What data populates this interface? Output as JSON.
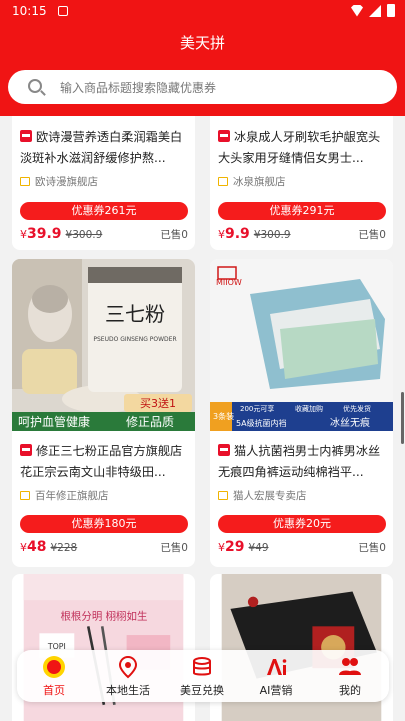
{
  "status": {
    "time": "10:15"
  },
  "header": {
    "title": "美天拼"
  },
  "search": {
    "placeholder": "输入商品标题搜索隐藏优惠券"
  },
  "products": [
    {
      "title": "欧诗漫营养透白柔润霜美白淡斑补水滋润舒缓修护熬...",
      "shop": "欧诗漫旗舰店",
      "coupon": "优惠券261元",
      "currency": "¥",
      "price": "39.9",
      "original": "¥300.9",
      "sold": "已售0"
    },
    {
      "title": "冰泉成人牙刷软毛护龈宽头大头家用牙缝情侣女男士...",
      "shop": "冰泉旗舰店",
      "coupon": "优惠券291元",
      "currency": "¥",
      "price": "9.9",
      "original": "¥300.9",
      "sold": "已售0"
    },
    {
      "title": "修正三七粉正品官方旗舰店花正宗云南文山非特级田...",
      "shop": "百年修正旗舰店",
      "coupon": "优惠券180元",
      "currency": "¥",
      "price": "48",
      "original": "¥228",
      "sold": "已售0",
      "image_texts": [
        "三七粉",
        "PSEUDO GINSENG POWDER",
        "呵护血管健康",
        "修正品质",
        "买3送1"
      ]
    },
    {
      "title": "猫人抗菌裆男士内裤男冰丝无痕四角裤运动纯棉裆平...",
      "shop": "猫人宏展专卖店",
      "coupon": "优惠券20元",
      "currency": "¥",
      "price": "29",
      "original": "¥49",
      "sold": "已售0",
      "image_texts": [
        "MIIOW",
        "5A级抗菌内裆",
        "冰丝无痕",
        "3条装",
        "200元可享",
        "收藏加购",
        "优先发货"
      ]
    },
    {
      "image_texts": [
        "根根分明 栩栩如生",
        "TOPI"
      ]
    },
    {
      "image_texts": []
    }
  ],
  "tabs": [
    {
      "label": "首页",
      "icon": "home-icon",
      "active": true
    },
    {
      "label": "本地生活",
      "icon": "location-icon",
      "active": false
    },
    {
      "label": "美豆兑换",
      "icon": "exchange-icon",
      "active": false
    },
    {
      "label": "AI营销",
      "icon": "ai-icon",
      "active": false
    },
    {
      "label": "我的",
      "icon": "user-icon",
      "active": false
    }
  ],
  "colors": {
    "brand": "#f01414",
    "coupon": "#f51c1c",
    "price": "#e8102a"
  }
}
